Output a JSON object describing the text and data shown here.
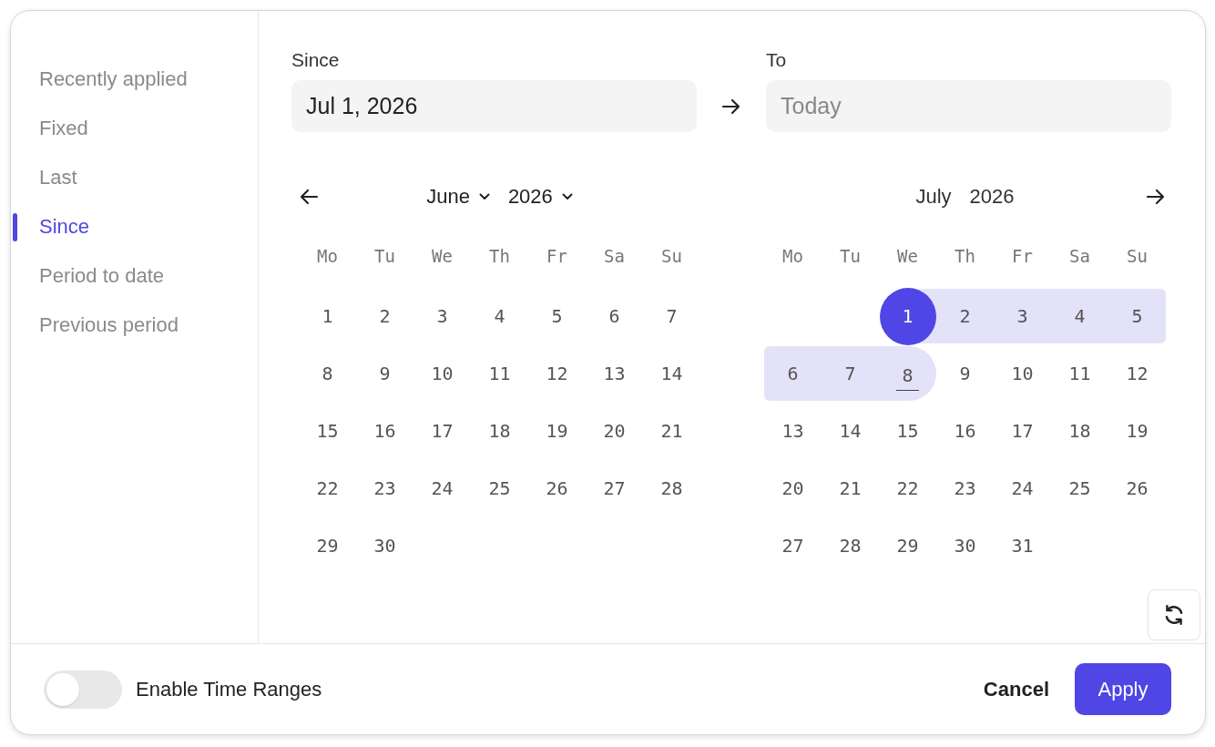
{
  "sidebar": {
    "items": [
      {
        "label": "Recently applied",
        "selected": false
      },
      {
        "label": "Fixed",
        "selected": false
      },
      {
        "label": "Last",
        "selected": false
      },
      {
        "label": "Since",
        "selected": true
      },
      {
        "label": "Period to date",
        "selected": false
      },
      {
        "label": "Previous period",
        "selected": false
      }
    ]
  },
  "since": {
    "label": "Since",
    "value": "Jul 1, 2026"
  },
  "to": {
    "label": "To",
    "placeholder": "Today"
  },
  "calendars": [
    {
      "prev_arrow": true,
      "next_arrow": false,
      "month": "June",
      "year": "2026",
      "dropdowns": true,
      "weekdays": [
        "Mo",
        "Tu",
        "We",
        "Th",
        "Fr",
        "Sa",
        "Su"
      ],
      "days": [
        {
          "kind": "day",
          "day": "1",
          "selected": false,
          "in_range": false,
          "today": false
        },
        {
          "kind": "day",
          "day": "2",
          "selected": false,
          "in_range": false,
          "today": false
        },
        {
          "kind": "day",
          "day": "3",
          "selected": false,
          "in_range": false,
          "today": false
        },
        {
          "kind": "day",
          "day": "4",
          "selected": false,
          "in_range": false,
          "today": false
        },
        {
          "kind": "day",
          "day": "5",
          "selected": false,
          "in_range": false,
          "today": false
        },
        {
          "kind": "day",
          "day": "6",
          "selected": false,
          "in_range": false,
          "today": false
        },
        {
          "kind": "day",
          "day": "7",
          "selected": false,
          "in_range": false,
          "today": false
        },
        {
          "kind": "day",
          "day": "8",
          "selected": false,
          "in_range": false,
          "today": false
        },
        {
          "kind": "day",
          "day": "9",
          "selected": false,
          "in_range": false,
          "today": false
        },
        {
          "kind": "day",
          "day": "10",
          "selected": false,
          "in_range": false,
          "today": false
        },
        {
          "kind": "day",
          "day": "11",
          "selected": false,
          "in_range": false,
          "today": false
        },
        {
          "kind": "day",
          "day": "12",
          "selected": false,
          "in_range": false,
          "today": false
        },
        {
          "kind": "day",
          "day": "13",
          "selected": false,
          "in_range": false,
          "today": false
        },
        {
          "kind": "day",
          "day": "14",
          "selected": false,
          "in_range": false,
          "today": false
        },
        {
          "kind": "day",
          "day": "15",
          "selected": false,
          "in_range": false,
          "today": false
        },
        {
          "kind": "day",
          "day": "16",
          "selected": false,
          "in_range": false,
          "today": false
        },
        {
          "kind": "day",
          "day": "17",
          "selected": false,
          "in_range": false,
          "today": false
        },
        {
          "kind": "day",
          "day": "18",
          "selected": false,
          "in_range": false,
          "today": false
        },
        {
          "kind": "day",
          "day": "19",
          "selected": false,
          "in_range": false,
          "today": false
        },
        {
          "kind": "day",
          "day": "20",
          "selected": false,
          "in_range": false,
          "today": false
        },
        {
          "kind": "day",
          "day": "21",
          "selected": false,
          "in_range": false,
          "today": false
        },
        {
          "kind": "day",
          "day": "22",
          "selected": false,
          "in_range": false,
          "today": false
        },
        {
          "kind": "day",
          "day": "23",
          "selected": false,
          "in_range": false,
          "today": false
        },
        {
          "kind": "day",
          "day": "24",
          "selected": false,
          "in_range": false,
          "today": false
        },
        {
          "kind": "day",
          "day": "25",
          "selected": false,
          "in_range": false,
          "today": false
        },
        {
          "kind": "day",
          "day": "26",
          "selected": false,
          "in_range": false,
          "today": false
        },
        {
          "kind": "day",
          "day": "27",
          "selected": false,
          "in_range": false,
          "today": false
        },
        {
          "kind": "day",
          "day": "28",
          "selected": false,
          "in_range": false,
          "today": false
        },
        {
          "kind": "day",
          "day": "29",
          "selected": false,
          "in_range": false,
          "today": false
        },
        {
          "kind": "day",
          "day": "30",
          "selected": false,
          "in_range": false,
          "today": false
        }
      ]
    },
    {
      "prev_arrow": false,
      "next_arrow": true,
      "month": "July",
      "year": "2026",
      "dropdowns": false,
      "weekdays": [
        "Mo",
        "Tu",
        "We",
        "Th",
        "Fr",
        "Sa",
        "Su"
      ],
      "days": [
        {
          "kind": "blank"
        },
        {
          "kind": "blank"
        },
        {
          "kind": "day",
          "day": "1",
          "selected": true,
          "in_range": true,
          "today": false
        },
        {
          "kind": "day",
          "day": "2",
          "selected": false,
          "in_range": true,
          "today": false
        },
        {
          "kind": "day",
          "day": "3",
          "selected": false,
          "in_range": true,
          "today": false
        },
        {
          "kind": "day",
          "day": "4",
          "selected": false,
          "in_range": true,
          "today": false
        },
        {
          "kind": "day",
          "day": "5",
          "selected": false,
          "in_range": true,
          "today": false
        },
        {
          "kind": "day",
          "day": "6",
          "selected": false,
          "in_range": true,
          "today": false
        },
        {
          "kind": "day",
          "day": "7",
          "selected": false,
          "in_range": true,
          "today": false
        },
        {
          "kind": "day",
          "day": "8",
          "selected": false,
          "in_range": true,
          "today": true
        },
        {
          "kind": "day",
          "day": "9",
          "selected": false,
          "in_range": false,
          "today": false
        },
        {
          "kind": "day",
          "day": "10",
          "selected": false,
          "in_range": false,
          "today": false
        },
        {
          "kind": "day",
          "day": "11",
          "selected": false,
          "in_range": false,
          "today": false
        },
        {
          "kind": "day",
          "day": "12",
          "selected": false,
          "in_range": false,
          "today": false
        },
        {
          "kind": "day",
          "day": "13",
          "selected": false,
          "in_range": false,
          "today": false
        },
        {
          "kind": "day",
          "day": "14",
          "selected": false,
          "in_range": false,
          "today": false
        },
        {
          "kind": "day",
          "day": "15",
          "selected": false,
          "in_range": false,
          "today": false
        },
        {
          "kind": "day",
          "day": "16",
          "selected": false,
          "in_range": false,
          "today": false
        },
        {
          "kind": "day",
          "day": "17",
          "selected": false,
          "in_range": false,
          "today": false
        },
        {
          "kind": "day",
          "day": "18",
          "selected": false,
          "in_range": false,
          "today": false
        },
        {
          "kind": "day",
          "day": "19",
          "selected": false,
          "in_range": false,
          "today": false
        },
        {
          "kind": "day",
          "day": "20",
          "selected": false,
          "in_range": false,
          "today": false
        },
        {
          "kind": "day",
          "day": "21",
          "selected": false,
          "in_range": false,
          "today": false
        },
        {
          "kind": "day",
          "day": "22",
          "selected": false,
          "in_range": false,
          "today": false
        },
        {
          "kind": "day",
          "day": "23",
          "selected": false,
          "in_range": false,
          "today": false
        },
        {
          "kind": "day",
          "day": "24",
          "selected": false,
          "in_range": false,
          "today": false
        },
        {
          "kind": "day",
          "day": "25",
          "selected": false,
          "in_range": false,
          "today": false
        },
        {
          "kind": "day",
          "day": "26",
          "selected": false,
          "in_range": false,
          "today": false
        },
        {
          "kind": "day",
          "day": "27",
          "selected": false,
          "in_range": false,
          "today": false
        },
        {
          "kind": "day",
          "day": "28",
          "selected": false,
          "in_range": false,
          "today": false
        },
        {
          "kind": "day",
          "day": "29",
          "selected": false,
          "in_range": false,
          "today": false
        },
        {
          "kind": "day",
          "day": "30",
          "selected": false,
          "in_range": false,
          "today": false
        },
        {
          "kind": "day",
          "day": "31",
          "selected": false,
          "in_range": false,
          "today": false
        }
      ]
    }
  ],
  "toggle": {
    "label": "Enable Time Ranges",
    "on": false
  },
  "buttons": [
    {
      "kind": "secondary",
      "label": "Cancel"
    },
    {
      "kind": "primary",
      "label": "Apply"
    }
  ]
}
